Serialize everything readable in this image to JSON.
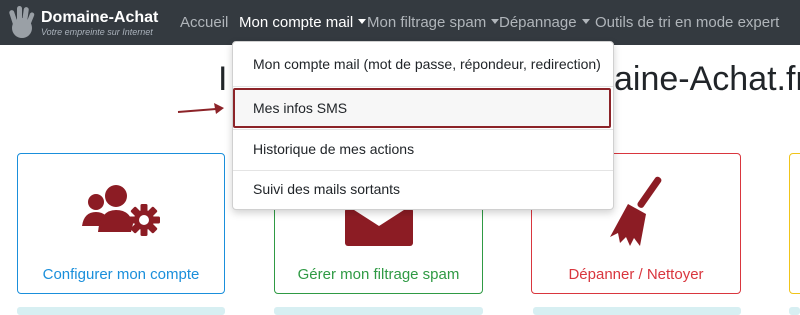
{
  "brand": {
    "name": "Domaine-Achat",
    "tagline": "Votre empreinte sur Internet"
  },
  "nav": {
    "items": [
      {
        "label": "Accueil",
        "dropdown": false,
        "active": false
      },
      {
        "label": "Mon compte mail",
        "dropdown": true,
        "active": true
      },
      {
        "label": "Mon filtrage spam",
        "dropdown": true,
        "active": false
      },
      {
        "label": "Dépannage",
        "dropdown": true,
        "active": false
      },
      {
        "label": "Outils de tri en mode expert",
        "dropdown": false,
        "active": false
      }
    ]
  },
  "heading": {
    "left_part": "I",
    "right_part": "aine-Achat.fr"
  },
  "dropdown_menu": {
    "items": [
      {
        "label": "Mon compte mail (mot de passe, répondeur, redirection)"
      },
      {
        "label": "Mes infos SMS",
        "highlighted": true
      },
      {
        "label": "Historique de mes actions"
      },
      {
        "label": "Suivi des mails sortants"
      }
    ]
  },
  "cards": [
    {
      "label": "Configurer mon compte",
      "icon": "users-gear-icon",
      "color": "#1a8fdb",
      "border": "#1a8fdb"
    },
    {
      "label": "Gérer mon filtrage spam",
      "icon": "envelope-icon",
      "color": "#2f9a44",
      "border": "#2f9a44"
    },
    {
      "label": "Dépanner / Nettoyer",
      "icon": "broom-icon",
      "color": "#d9363e",
      "border": "#d9363e"
    }
  ],
  "colors": {
    "navbar": "#343a40",
    "accent": "#8c2328",
    "icon": "#8c1c24"
  }
}
